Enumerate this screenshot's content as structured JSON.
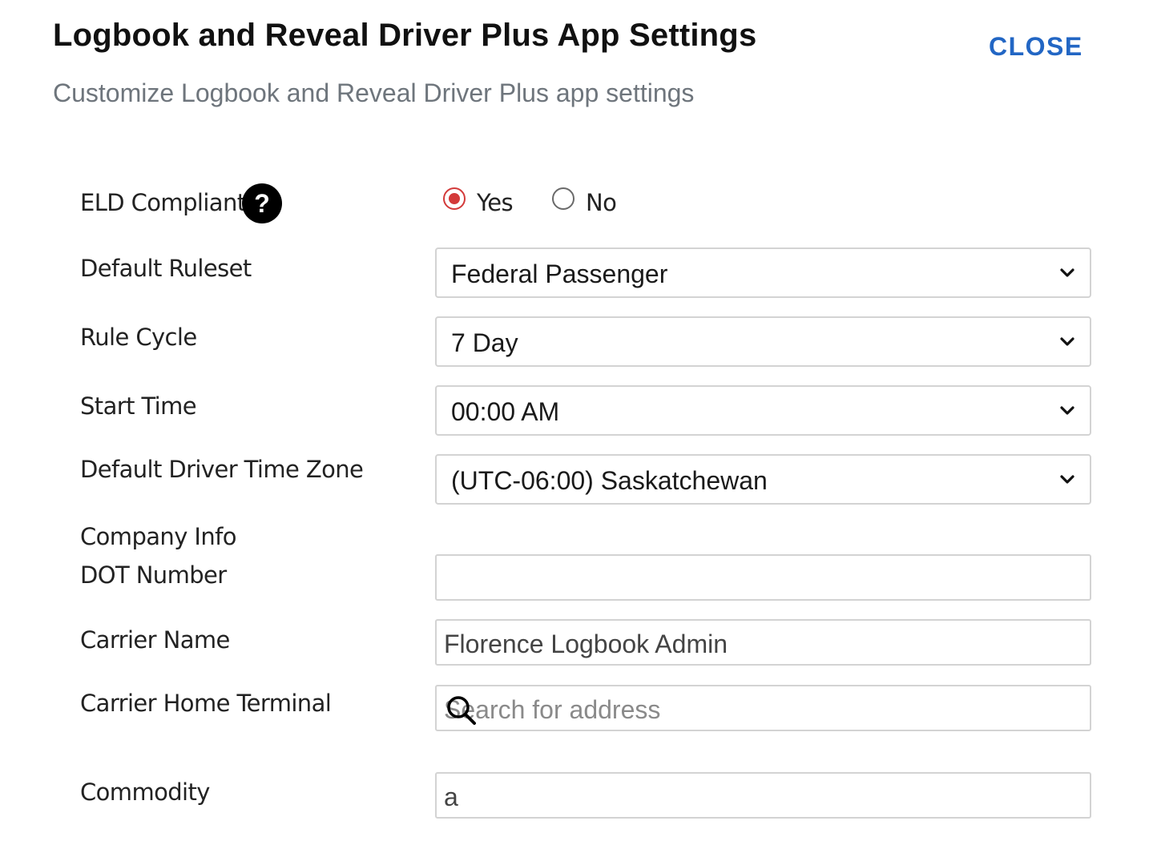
{
  "dialog": {
    "title": "Logbook and Reveal Driver Plus App Settings",
    "subtitle": "Customize Logbook and Reveal Driver Plus app settings",
    "close_label": "CLOSE"
  },
  "eld_compliant": {
    "label": "ELD Compliant",
    "help_icon_glyph": "?",
    "options": [
      {
        "label": "Yes",
        "selected": true
      },
      {
        "label": "No",
        "selected": false
      }
    ]
  },
  "default_ruleset": {
    "label": "Default Ruleset",
    "value": "Federal Passenger"
  },
  "rule_cycle": {
    "label": "Rule Cycle",
    "value": "7 Day"
  },
  "start_time": {
    "label": "Start Time",
    "value": "00:00 AM"
  },
  "default_driver_time_zone": {
    "label": "Default Driver Time Zone",
    "value": "(UTC-06:00) Saskatchewan"
  },
  "company_info": {
    "heading": "Company Info",
    "dot_number": {
      "label": "DOT Number",
      "value": ""
    },
    "carrier_name": {
      "label": "Carrier Name",
      "value": "Florence Logbook Admin"
    },
    "carrier_home_terminal": {
      "label": "Carrier Home Terminal",
      "placeholder": "Search for address"
    },
    "commodity": {
      "label": "Commodity",
      "value": "a"
    }
  },
  "colors": {
    "accent_link": "#2266c4",
    "radio_selected": "#d33a3a",
    "border": "#d3d3d3"
  },
  "icons": {
    "help": "question-circle-icon",
    "dropdown": "chevron-down-icon",
    "search": "search-icon"
  }
}
